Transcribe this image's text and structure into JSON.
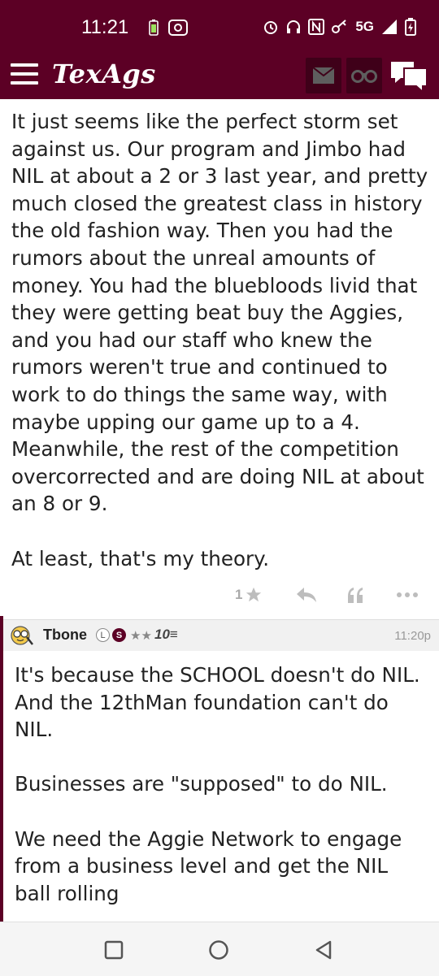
{
  "status_bar": {
    "time": "11:21",
    "network": "5G"
  },
  "header": {
    "logo": "TexAgs"
  },
  "post": {
    "paragraphs": [
      "It just seems like the perfect storm set against us. Our program and Jimbo had NIL at about a 2 or 3 last year, and pretty much closed the greatest class in history the old fashion way. Then you had the rumors about the unreal amounts of money. You had the bluebloods livid that they were getting beat buy the Aggies, and you had our staff who knew the rumors weren't true and continued to work to do things the same way, with maybe upping our game up to a 4. Meanwhile, the rest of the competition overcorrected and are doing NIL at about an 8 or 9.",
      "At least, that's my theory."
    ],
    "stars": "1"
  },
  "reply": {
    "username": "Tbone",
    "badge_l": "L",
    "badge_s": "S",
    "stars": "★★",
    "level": "10≡",
    "time": "11:20p",
    "paragraphs": [
      "It's because the SCHOOL doesn't do NIL. And the 12thMan foundation can't do NIL.",
      "Businesses are \"supposed\" to do NIL.",
      "We need the Aggie Network to engage from a business level and get the NIL ball rolling"
    ]
  },
  "colors": {
    "brand": "#5c0025",
    "icon_gray": "#bdbdbd"
  }
}
